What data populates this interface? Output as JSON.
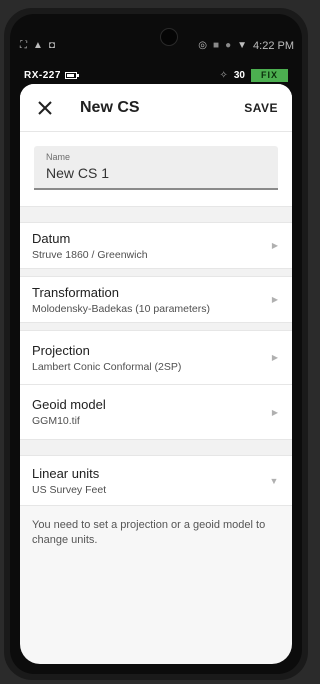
{
  "statusbar": {
    "left_icons": [
      "image-icon",
      "notification-icon",
      "watch-icon"
    ],
    "right_icons": [
      "hotspot-icon",
      "cast-icon",
      "record-icon",
      "wifi-icon"
    ],
    "time": "4:22 PM"
  },
  "gnss": {
    "device": "RX-227",
    "satellites": "30",
    "fix_status": "FIX",
    "fix_color": "#4caf50"
  },
  "appbar": {
    "title": "New CS",
    "save_label": "SAVE"
  },
  "name_field": {
    "label": "Name",
    "value": "New CS 1"
  },
  "settings": [
    {
      "title": "Datum",
      "value": "Struve 1860 / Greenwich"
    },
    {
      "title": "Transformation",
      "value": "Molodensky-Badekas (10 parameters)"
    },
    {
      "title": "Projection",
      "value": "Lambert Conic Conformal (2SP)"
    },
    {
      "title": "Geoid model",
      "value": "GGM10.tif"
    }
  ],
  "units": {
    "title": "Linear units",
    "value": "US Survey Feet",
    "note": "You need to set a projection or a geoid model to change units."
  }
}
